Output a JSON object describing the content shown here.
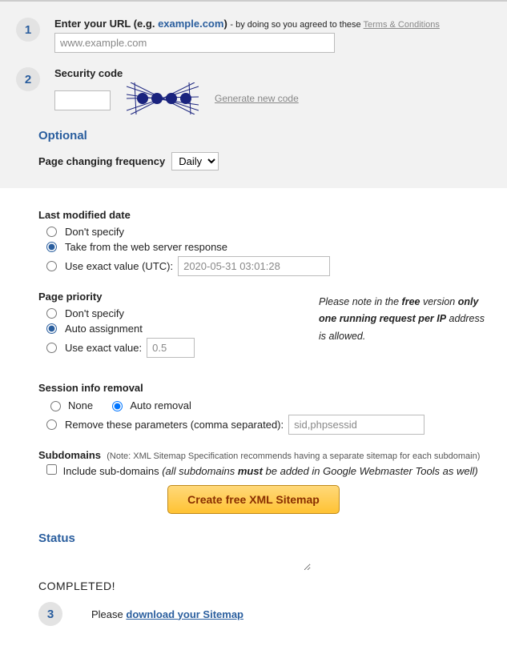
{
  "step1": {
    "num": "1",
    "label": "Enter your URL (e.g. ",
    "example_link": "example.com",
    "label_after": ") ",
    "sub": "- by doing so you agreed to these ",
    "terms_link": "Terms & Conditions",
    "url_value": "www.example.com"
  },
  "step2": {
    "num": "2",
    "label": "Security code",
    "generate": "Generate new code"
  },
  "optional": {
    "heading": "Optional",
    "freq_label": "Page changing frequency",
    "freq_value": "Daily"
  },
  "lastmod": {
    "title": "Last modified date",
    "opt1": "Don't specify",
    "opt2": "Take from the web server response",
    "opt3": "Use exact value (UTC):",
    "date_value": "2020-05-31 03:01:28"
  },
  "priority": {
    "title": "Page priority",
    "opt1": "Don't specify",
    "opt2": "Auto assignment",
    "opt3": "Use exact value:",
    "value": "0.5",
    "note_prefix": "Please note in the ",
    "note_free": "free",
    "note_mid1": " version ",
    "note_only": "only one running request per IP",
    "note_end": " address is allowed."
  },
  "session": {
    "title": "Session info removal",
    "opt1": "None",
    "opt2": "Auto removal",
    "opt3": "Remove these parameters (comma separated):",
    "value": "sid,phpsessid"
  },
  "subdomains": {
    "title": "Subdomains",
    "note": "(Note: XML Sitemap Specification recommends having a separate sitemap for each subdomain)",
    "check_label": "Include sub-domains ",
    "italic_prefix": "(all subdomains ",
    "italic_bold": "must",
    "italic_end": " be added in Google Webmaster Tools as well)"
  },
  "button": "Create free XML Sitemap",
  "status": {
    "heading": "Status",
    "completed": "COMPLETED!"
  },
  "step3": {
    "num": "3",
    "prefix": "Please ",
    "link": "download your Sitemap"
  }
}
